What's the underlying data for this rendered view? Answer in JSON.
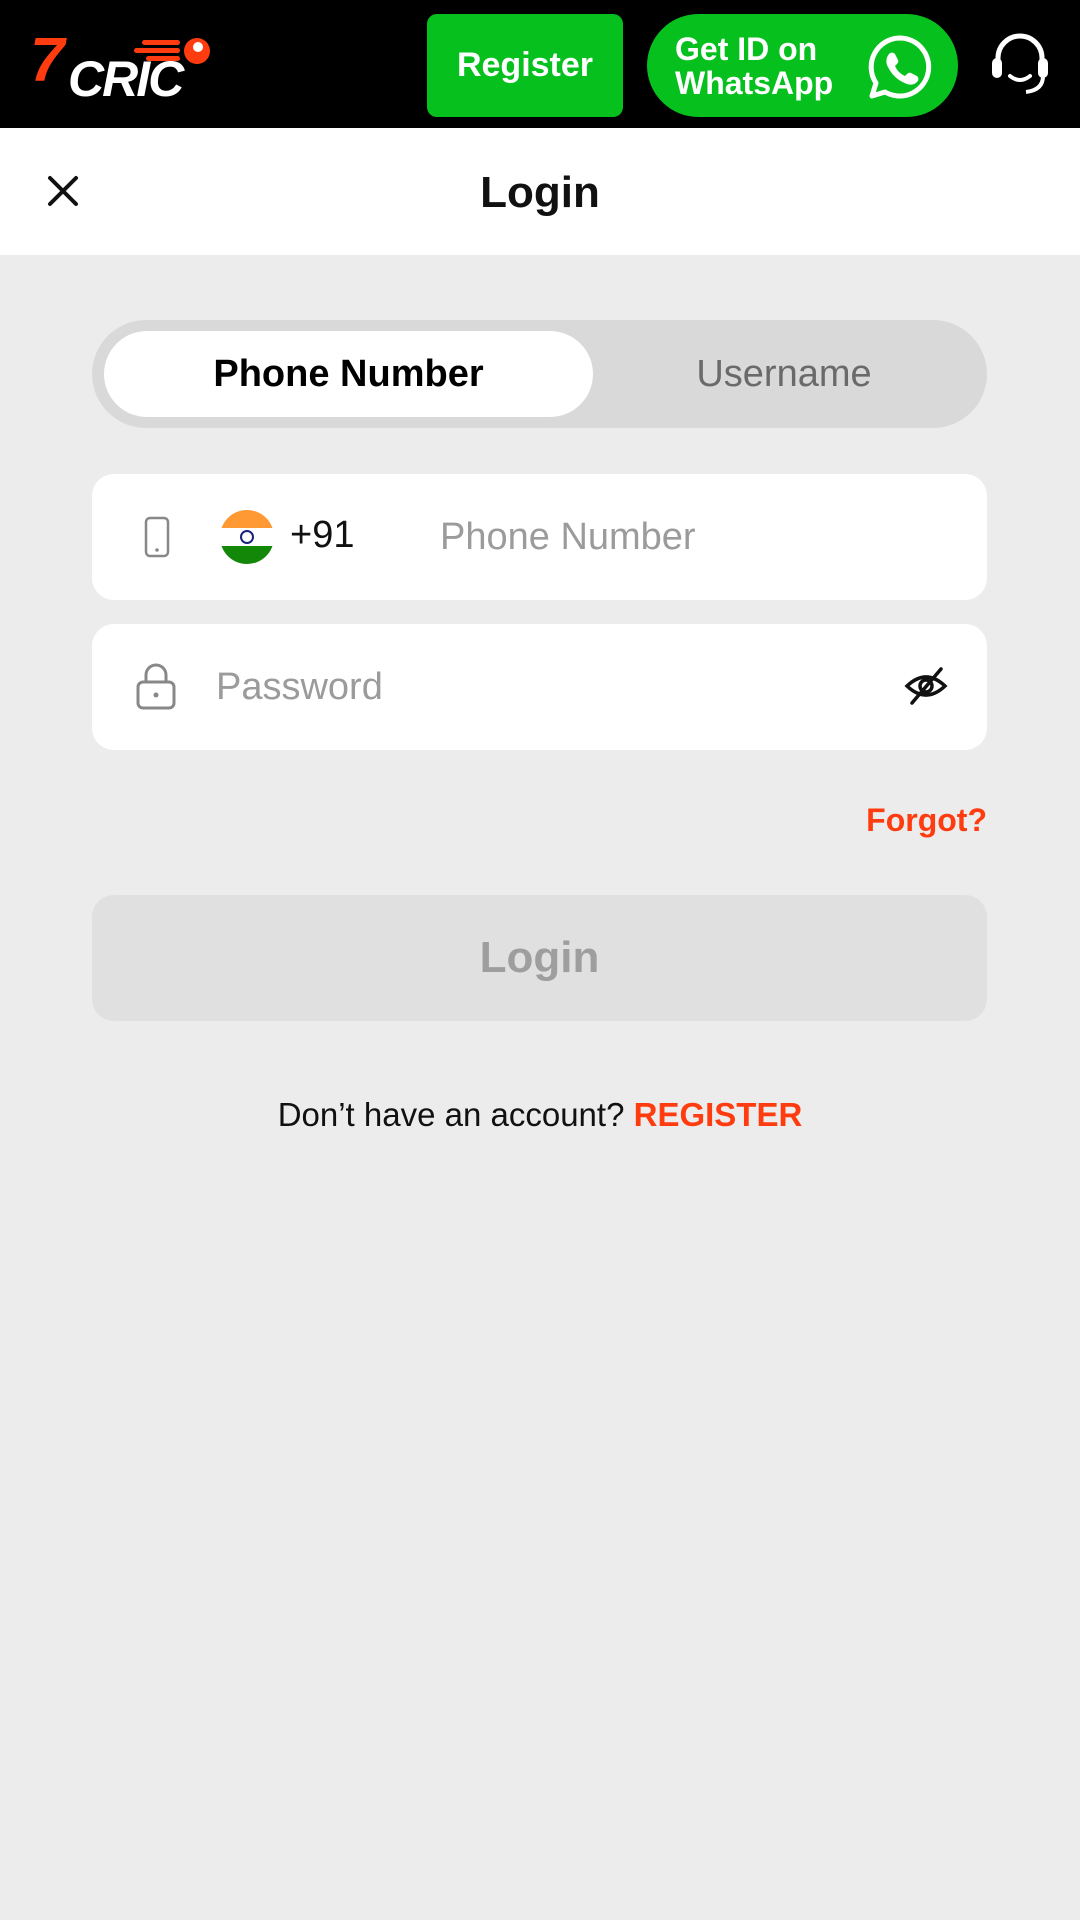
{
  "header": {
    "logo_text_number": "7",
    "logo_text_word": "CRIC",
    "register_label": "Register",
    "whatsapp_line1": "Get ID on",
    "whatsapp_line2": "WhatsApp",
    "brand_color": "#ff3c0f",
    "green_color": "#06c01e"
  },
  "titlebar": {
    "title": "Login"
  },
  "login_mode": {
    "tabs": [
      {
        "label": "Phone Number",
        "active": true
      },
      {
        "label": "Username",
        "active": false
      }
    ]
  },
  "form": {
    "country_code": "+91",
    "phone_placeholder": "Phone Number",
    "phone_value": "",
    "password_placeholder": "Password",
    "password_value": "",
    "forgot_label": "Forgot?",
    "login_label": "Login"
  },
  "footer": {
    "prompt": "Don’t have an account?",
    "register_label": "REGISTER"
  }
}
